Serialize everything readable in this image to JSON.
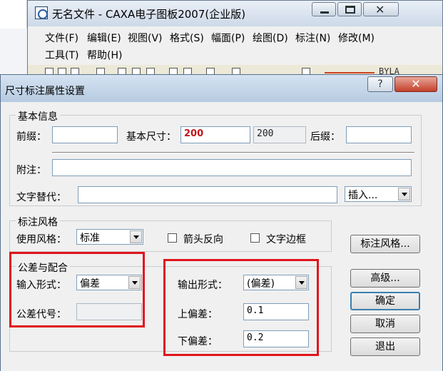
{
  "main_window": {
    "title": "无名文件 - CAXA电子图板2007(企业版)",
    "close_glyph": "✕",
    "menu": [
      "文件(F)",
      "编辑(E)",
      "视图(V)",
      "格式(S)",
      "幅面(P)",
      "绘图(D)",
      "标注(N)",
      "修改(M)",
      "工具(T)",
      "帮助(H)"
    ],
    "toolbar_text": "BYLA"
  },
  "dialog": {
    "title": "尺寸标注属性设置",
    "help_glyph": "?",
    "close_glyph": "✕",
    "basic_info": {
      "group_label": "基本信息",
      "prefix_label": "前缀：",
      "prefix_value": "",
      "base_size_label": "基本尺寸：",
      "base_size_value": "200",
      "base_size_measured": "200",
      "suffix_label": "后缀：",
      "suffix_value": "",
      "note_label": "附注：",
      "note_value": "",
      "text_replace_label": "文字替代：",
      "text_replace_value": "",
      "insert_label": "插入..."
    },
    "style": {
      "group_label": "标注风格",
      "use_style_label": "使用风格：",
      "use_style_value": "标准",
      "arrow_reverse_label": "箭头反向",
      "arrow_reverse_checked": false,
      "text_border_label": "文字边框",
      "text_border_checked": false,
      "style_button": "标注风格..."
    },
    "tolerance": {
      "group_label": "公差与配合",
      "input_form_label": "输入形式：",
      "input_form_value": "偏差",
      "tol_code_label": "公差代号：",
      "tol_code_value": "",
      "output_form_label": "输出形式：",
      "output_form_value": "(偏差)",
      "upper_dev_label": "上偏差：",
      "upper_dev_value": "0.1",
      "lower_dev_label": "下偏差：",
      "lower_dev_value": "0.2"
    },
    "buttons": {
      "advanced": "高级...",
      "ok": "确定",
      "cancel": "取消",
      "exit": "退出"
    }
  }
}
